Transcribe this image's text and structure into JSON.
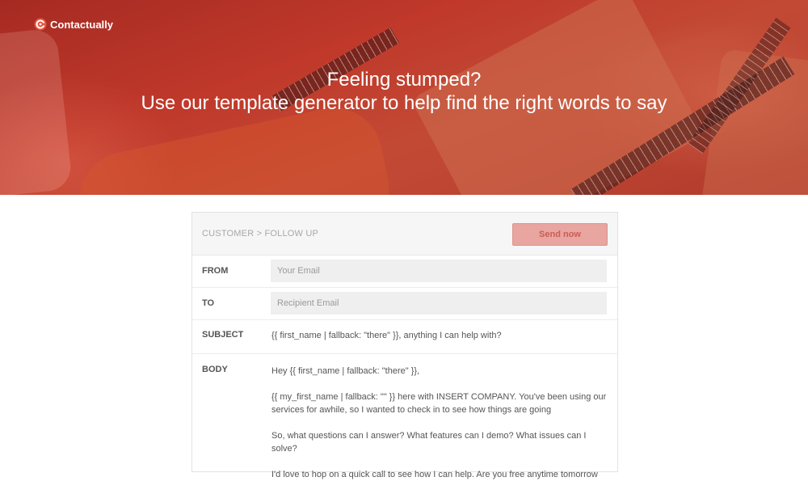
{
  "brand": {
    "name": "Contactually",
    "logo_icon": "contactually-logo-icon"
  },
  "hero": {
    "line1": "Feeling stumped?",
    "line2": "Use our template generator to help find the right words to say"
  },
  "composer": {
    "breadcrumb": "CUSTOMER > FOLLOW UP",
    "send_label": "Send now",
    "from_label": "FROM",
    "from_placeholder": "Your Email",
    "to_label": "TO",
    "to_placeholder": "Recipient Email",
    "subject_label": "SUBJECT",
    "subject_value": "{{ first_name | fallback: \"there\" }}, anything I can help with?",
    "body_label": "BODY",
    "body_paragraphs": [
      "Hey {{ first_name | fallback: \"there\" }},",
      "{{ my_first_name | fallback: \"\" }} here with INSERT COMPANY. You've been using our services for awhile, so I wanted to check in to see how things are going",
      "So, what questions can I answer? What features can I demo? What issues can I solve?",
      "I'd love to hop on a quick call to see how I can help. Are you free anytime tomorrow"
    ]
  },
  "colors": {
    "hero_red": "#b23a2c",
    "send_button": "#e9a5a0",
    "panel_header": "#f6f6f6"
  }
}
